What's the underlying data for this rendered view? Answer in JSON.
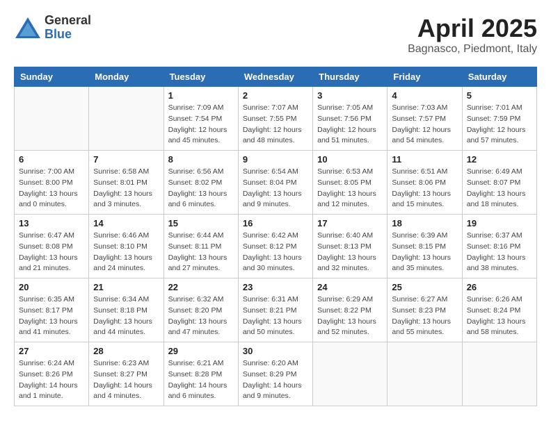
{
  "header": {
    "logo_general": "General",
    "logo_blue": "Blue",
    "title": "April 2025",
    "subtitle": "Bagnasco, Piedmont, Italy"
  },
  "columns": [
    "Sunday",
    "Monday",
    "Tuesday",
    "Wednesday",
    "Thursday",
    "Friday",
    "Saturday"
  ],
  "weeks": [
    [
      {
        "day": "",
        "detail": ""
      },
      {
        "day": "",
        "detail": ""
      },
      {
        "day": "1",
        "detail": "Sunrise: 7:09 AM\nSunset: 7:54 PM\nDaylight: 12 hours\nand 45 minutes."
      },
      {
        "day": "2",
        "detail": "Sunrise: 7:07 AM\nSunset: 7:55 PM\nDaylight: 12 hours\nand 48 minutes."
      },
      {
        "day": "3",
        "detail": "Sunrise: 7:05 AM\nSunset: 7:56 PM\nDaylight: 12 hours\nand 51 minutes."
      },
      {
        "day": "4",
        "detail": "Sunrise: 7:03 AM\nSunset: 7:57 PM\nDaylight: 12 hours\nand 54 minutes."
      },
      {
        "day": "5",
        "detail": "Sunrise: 7:01 AM\nSunset: 7:59 PM\nDaylight: 12 hours\nand 57 minutes."
      }
    ],
    [
      {
        "day": "6",
        "detail": "Sunrise: 7:00 AM\nSunset: 8:00 PM\nDaylight: 13 hours\nand 0 minutes."
      },
      {
        "day": "7",
        "detail": "Sunrise: 6:58 AM\nSunset: 8:01 PM\nDaylight: 13 hours\nand 3 minutes."
      },
      {
        "day": "8",
        "detail": "Sunrise: 6:56 AM\nSunset: 8:02 PM\nDaylight: 13 hours\nand 6 minutes."
      },
      {
        "day": "9",
        "detail": "Sunrise: 6:54 AM\nSunset: 8:04 PM\nDaylight: 13 hours\nand 9 minutes."
      },
      {
        "day": "10",
        "detail": "Sunrise: 6:53 AM\nSunset: 8:05 PM\nDaylight: 13 hours\nand 12 minutes."
      },
      {
        "day": "11",
        "detail": "Sunrise: 6:51 AM\nSunset: 8:06 PM\nDaylight: 13 hours\nand 15 minutes."
      },
      {
        "day": "12",
        "detail": "Sunrise: 6:49 AM\nSunset: 8:07 PM\nDaylight: 13 hours\nand 18 minutes."
      }
    ],
    [
      {
        "day": "13",
        "detail": "Sunrise: 6:47 AM\nSunset: 8:08 PM\nDaylight: 13 hours\nand 21 minutes."
      },
      {
        "day": "14",
        "detail": "Sunrise: 6:46 AM\nSunset: 8:10 PM\nDaylight: 13 hours\nand 24 minutes."
      },
      {
        "day": "15",
        "detail": "Sunrise: 6:44 AM\nSunset: 8:11 PM\nDaylight: 13 hours\nand 27 minutes."
      },
      {
        "day": "16",
        "detail": "Sunrise: 6:42 AM\nSunset: 8:12 PM\nDaylight: 13 hours\nand 30 minutes."
      },
      {
        "day": "17",
        "detail": "Sunrise: 6:40 AM\nSunset: 8:13 PM\nDaylight: 13 hours\nand 32 minutes."
      },
      {
        "day": "18",
        "detail": "Sunrise: 6:39 AM\nSunset: 8:15 PM\nDaylight: 13 hours\nand 35 minutes."
      },
      {
        "day": "19",
        "detail": "Sunrise: 6:37 AM\nSunset: 8:16 PM\nDaylight: 13 hours\nand 38 minutes."
      }
    ],
    [
      {
        "day": "20",
        "detail": "Sunrise: 6:35 AM\nSunset: 8:17 PM\nDaylight: 13 hours\nand 41 minutes."
      },
      {
        "day": "21",
        "detail": "Sunrise: 6:34 AM\nSunset: 8:18 PM\nDaylight: 13 hours\nand 44 minutes."
      },
      {
        "day": "22",
        "detail": "Sunrise: 6:32 AM\nSunset: 8:20 PM\nDaylight: 13 hours\nand 47 minutes."
      },
      {
        "day": "23",
        "detail": "Sunrise: 6:31 AM\nSunset: 8:21 PM\nDaylight: 13 hours\nand 50 minutes."
      },
      {
        "day": "24",
        "detail": "Sunrise: 6:29 AM\nSunset: 8:22 PM\nDaylight: 13 hours\nand 52 minutes."
      },
      {
        "day": "25",
        "detail": "Sunrise: 6:27 AM\nSunset: 8:23 PM\nDaylight: 13 hours\nand 55 minutes."
      },
      {
        "day": "26",
        "detail": "Sunrise: 6:26 AM\nSunset: 8:24 PM\nDaylight: 13 hours\nand 58 minutes."
      }
    ],
    [
      {
        "day": "27",
        "detail": "Sunrise: 6:24 AM\nSunset: 8:26 PM\nDaylight: 14 hours\nand 1 minute."
      },
      {
        "day": "28",
        "detail": "Sunrise: 6:23 AM\nSunset: 8:27 PM\nDaylight: 14 hours\nand 4 minutes."
      },
      {
        "day": "29",
        "detail": "Sunrise: 6:21 AM\nSunset: 8:28 PM\nDaylight: 14 hours\nand 6 minutes."
      },
      {
        "day": "30",
        "detail": "Sunrise: 6:20 AM\nSunset: 8:29 PM\nDaylight: 14 hours\nand 9 minutes."
      },
      {
        "day": "",
        "detail": ""
      },
      {
        "day": "",
        "detail": ""
      },
      {
        "day": "",
        "detail": ""
      }
    ]
  ]
}
